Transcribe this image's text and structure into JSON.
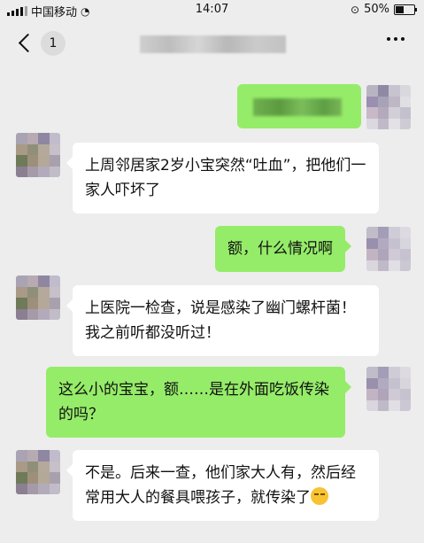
{
  "status_bar": {
    "carrier": "中国移动",
    "time": "14:07",
    "battery": "50%",
    "battery_level": 0.5
  },
  "nav": {
    "unread_count": "1"
  },
  "messages": [
    {
      "side": "right",
      "text": ""
    },
    {
      "side": "left",
      "text": "上周邻居家2岁小宝突然“吐血”，把他们一家人吓坏了"
    },
    {
      "side": "right",
      "text": "额，什么情况啊"
    },
    {
      "side": "left",
      "text": "上医院一检查，说是感染了幽门螺杆菌！我之前听都没听过！"
    },
    {
      "side": "right",
      "text": "这么小的宝宝，额……是在外面吃饭传染的吗？"
    },
    {
      "side": "left",
      "text": "不是。后来一查，他们家大人有，然后经常用大人的餐具喂孩子，就传染了",
      "emoji": "smirk-emoji"
    }
  ]
}
